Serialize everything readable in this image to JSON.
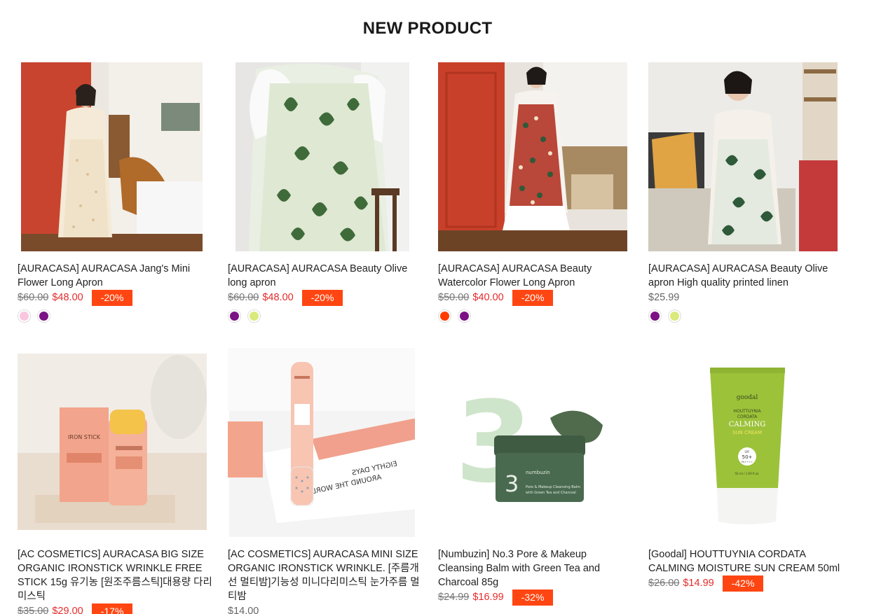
{
  "section": {
    "title": "NEW PRODUCT"
  },
  "products": [
    {
      "title": "[AURACASA] AURACASA Jang's Mini Flower Long Apron",
      "old_price": "$60.00",
      "price": "$48.00",
      "badge": "-20%",
      "swatches": [
        "#f9c6de",
        "#7b1185"
      ]
    },
    {
      "title": "[AURACASA] AURACASA Beauty Olive long apron",
      "old_price": "$60.00",
      "price": "$48.00",
      "badge": "-20%",
      "swatches": [
        "#7b1185",
        "#dbe97c"
      ]
    },
    {
      "title": "[AURACASA] AURACASA Beauty Watercolor Flower Long Apron",
      "old_price": "$50.00",
      "price": "$40.00",
      "badge": "-20%",
      "swatches": [
        "#ff3b00",
        "#7b1185"
      ]
    },
    {
      "title": "[AURACASA] AURACASA Beauty Olive apron High quality printed linen",
      "price": "$25.99",
      "swatches": [
        "#7b1185",
        "#dbe97c"
      ]
    },
    {
      "title": "[AC COSMETICS] AURACASA BIG SIZE ORGANIC IRONSTICK WRINKLE FREE STICK 15g 유기농 [원조주름스틱]대용량 다리미스틱",
      "old_price": "$35.00",
      "price": "$29.00",
      "badge": "-17%"
    },
    {
      "title": "[AC COSMETICS] AURACASA MINI SIZE ORGANIC IRONSTICK WRINKLE. [주름개선 멀티밤]기능성 미니다리미스틱 눈가주름 멀티밤",
      "price": "$14.00"
    },
    {
      "title": "[Numbuzin] No.3 Pore & Makeup Cleansing Balm with Green Tea and Charcoal 85g",
      "old_price": "$24.99",
      "price": "$16.99",
      "badge": "-32%"
    },
    {
      "title": "[Goodal] HOUTTUYNIA CORDATA CALMING MOISTURE SUN CREAM 50ml",
      "old_price": "$26.00",
      "price": "$14.99",
      "badge": "-42%"
    }
  ],
  "image_text": {
    "balm_number": "3",
    "balm_brand": "numbuzin",
    "balm_line1": "Pore & Makeup Cleansing Balm",
    "balm_line2": "with Green Tea and Charcoal",
    "stick_brand": "IRON STICK",
    "book_line1": "AROUND THE WORLD IN",
    "book_line2": "EIGHTY DAYS",
    "tube_brand": "goodal",
    "tube_line1": "HOUTTUYNIA",
    "tube_line2": "CORDATA",
    "tube_line3": "CALMING",
    "tube_line4": "SUN CREAM",
    "tube_spf": "SPF",
    "tube_spf_value": "50+",
    "tube_pa": "PA++++",
    "tube_volume": "50 ml / 1.69 fl.oz."
  }
}
